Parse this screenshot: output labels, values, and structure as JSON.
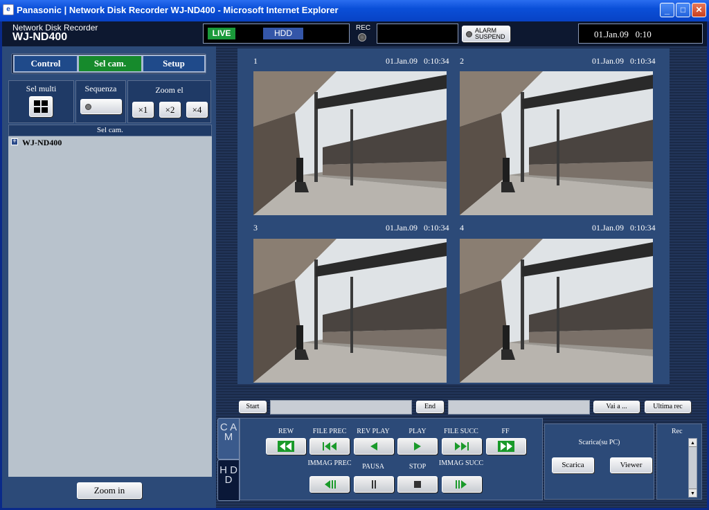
{
  "window": {
    "title": "Panasonic | Network Disk Recorder WJ-ND400 - Microsoft Internet Explorer",
    "app_icon": "ie-icon",
    "controls": {
      "minimize": "_",
      "maximize": "□",
      "close": "✕"
    }
  },
  "header": {
    "product_line": "Network Disk Recorder",
    "model": "WJ-ND400",
    "live_label": "LIVE",
    "hdd_label": "HDD",
    "rec_label": "REC",
    "alarm_line1": "ALARM",
    "alarm_line2": "SUSPEND",
    "datetime": "01.Jan.09   0:10"
  },
  "tabs": [
    {
      "label": "Control",
      "active": false
    },
    {
      "label": "Sel cam.",
      "active": true
    },
    {
      "label": "Setup",
      "active": false
    }
  ],
  "toolbar": {
    "sel_multi": "Sel multi",
    "sequenza": "Sequenza",
    "zoom_el": "Zoom el",
    "zoom_x1": "×1",
    "zoom_x2": "×2",
    "zoom_x4": "×4"
  },
  "camera_tree": {
    "header": "Sel cam.",
    "expand_glyph": "+",
    "root": "WJ-ND400"
  },
  "zoom_in_button": "Zoom in",
  "cameras": [
    {
      "number": "1",
      "timestamp": "01.Jan.09   0:10:34"
    },
    {
      "number": "2",
      "timestamp": "01.Jan.09   0:10:34"
    },
    {
      "number": "3",
      "timestamp": "01.Jan.09   0:10:34"
    },
    {
      "number": "4",
      "timestamp": "01.Jan.09   0:10:34"
    }
  ],
  "timeline": {
    "start_button": "Start",
    "start_value": "",
    "end_button": "End",
    "end_value": "",
    "goto_button": "Vai a ...",
    "last_rec_button": "Ultima rec"
  },
  "side_tabs": {
    "cam": "C A M",
    "hdd": "H D D"
  },
  "playback": {
    "rew": "REW",
    "file_prec": "FILE PREC",
    "rev_play": "REV PLAY",
    "play": "PLAY",
    "file_succ": "FILE SUCC",
    "ff": "FF",
    "immag_prec": "IMMAG PREC",
    "pausa": "PAUSA",
    "stop": "STOP",
    "immag_succ": "IMMAG SUCC"
  },
  "download": {
    "title": "Scarica(su PC)",
    "scarica_button": "Scarica",
    "viewer_button": "Viewer"
  },
  "rec_panel": {
    "label": "Rec"
  },
  "colors": {
    "titlebar": "#0a4fd8",
    "live_green": "#1a9a3a",
    "active_tab": "#168a2c",
    "panel": "#2c4a78",
    "play_green": "#1a9a2a"
  }
}
